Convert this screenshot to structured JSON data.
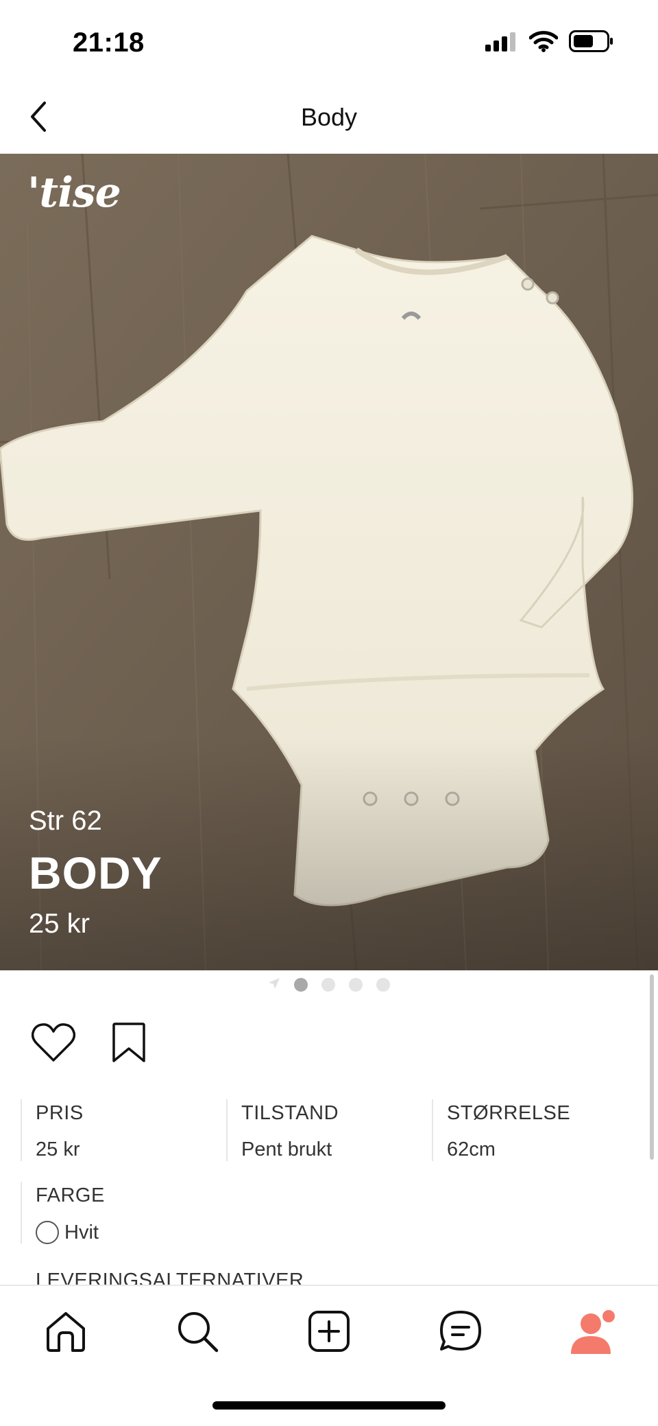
{
  "status_bar": {
    "time": "21:18",
    "icons": [
      "signal-icon",
      "wifi-icon",
      "battery-icon"
    ]
  },
  "nav": {
    "title": "Body",
    "back_icon": "chevron-left-icon"
  },
  "hero": {
    "brand": "'tise",
    "size_text": "Str 62",
    "title": "BODY",
    "price": "25 kr",
    "image_description_colors": {
      "floor": "#6f6252",
      "garment": "#f3efe2"
    }
  },
  "pager": {
    "count": 4,
    "active_index": 0
  },
  "actions": {
    "like_icon": "heart-icon",
    "save_icon": "bookmark-icon"
  },
  "details": [
    {
      "label": "PRIS",
      "value": "25 kr"
    },
    {
      "label": "TILSTAND",
      "value": "Pent brukt"
    },
    {
      "label": "STØRRELSE",
      "value": "62cm"
    }
  ],
  "color": {
    "label": "FARGE",
    "value": "Hvit",
    "swatch": "#ffffff"
  },
  "delivery": {
    "label": "LEVERINGSALTERNATIVER"
  },
  "tab_bar": {
    "items": [
      "home-icon",
      "search-icon",
      "add-icon",
      "chat-icon",
      "profile-icon"
    ],
    "profile_color": "#f47b6b"
  }
}
